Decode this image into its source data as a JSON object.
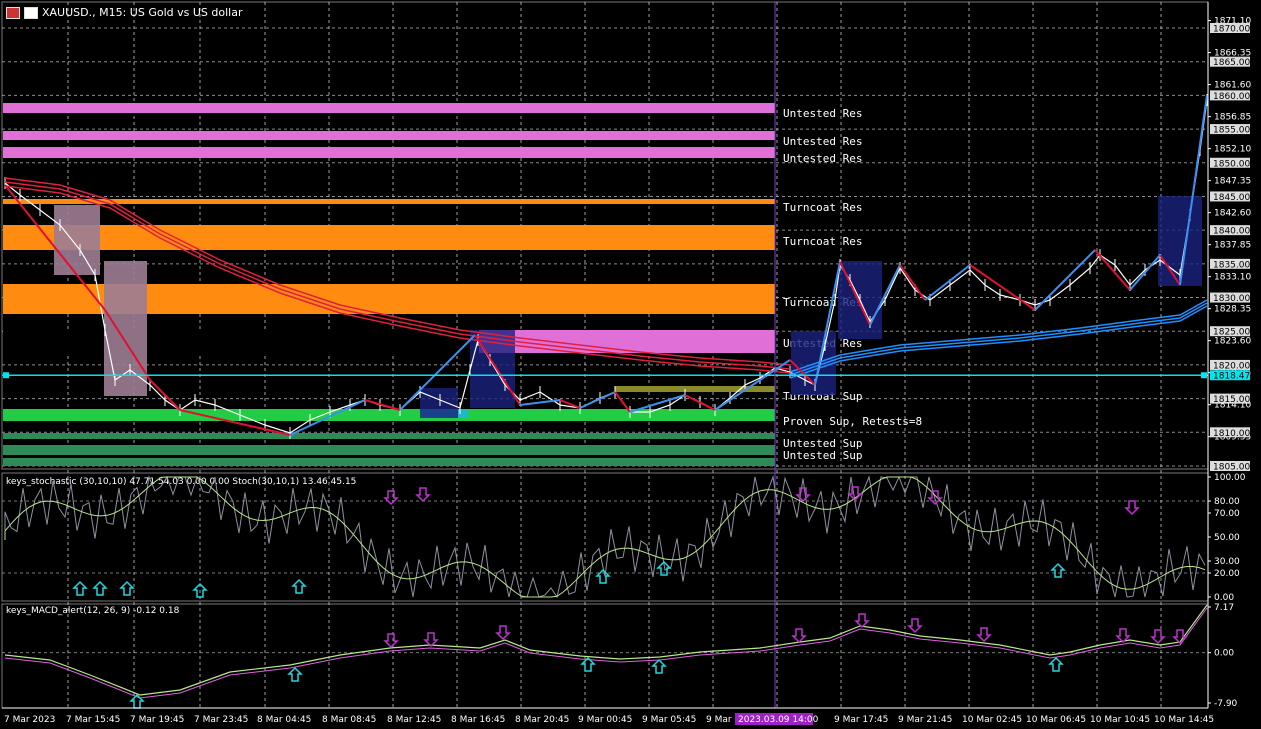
{
  "window": {
    "title": "XAUUSD., M15:  US Gold vs US dollar"
  },
  "colors": {
    "background": "#000000",
    "grid": "#c8c8c8",
    "untested_res": "#e070d8",
    "turncoat_res": "#ff8c10",
    "proven_sup": "#22cc44",
    "untested_sup": "#2e8b57",
    "candle": "#ffffff",
    "ma_red": "#e02040",
    "ma_blue": "#1e90ff",
    "zigzag_up": "#3a8ff0",
    "zigzag_down": "#e01030",
    "current_price": "#00e5ee",
    "stoch_main": "#9090a0",
    "stoch_signal": "#b8e88a",
    "arrow_up": "#20d8e0",
    "arrow_down": "#c030d0",
    "vline": "#7b3fd0"
  },
  "main_panel": {
    "price_labels": [
      "1871.10",
      "1866.35",
      "1861.60",
      "1856.85",
      "1852.10",
      "1847.35",
      "1842.60",
      "1837.85",
      "1833.10",
      "1828.35",
      "1823.60",
      "1818.85",
      "1814.10",
      "1809.35"
    ],
    "price_boxes": [
      "1870.00",
      "1865.00",
      "1860.00",
      "1855.00",
      "1850.00",
      "1845.00",
      "1840.00",
      "1835.00",
      "1830.00",
      "1825.00",
      "1820.00",
      "1815.00",
      "1810.00",
      "1805.00"
    ],
    "current_price": "1818.47",
    "zone_labels": [
      "Untested Res",
      "Untested Res",
      "Untested Res",
      "Turncoat Res",
      "Turncoat Res",
      "Turncoat Res",
      "Untested Res",
      "Turncoat Sup",
      "Proven Sup, Retests=8",
      "Untested Sup",
      "Untested Sup"
    ]
  },
  "stoch_panel": {
    "label": "keys_stochastic (30,10,10) 47.71 54.03 0.00 0.00 Stoch(30,10,1) 13.46 45.15",
    "levels": [
      "100.00",
      "80.00",
      "70.00",
      "50.00",
      "30.00",
      "20.00",
      "0.00"
    ]
  },
  "macd_panel": {
    "label": "keys_MACD_alert(12, 26, 9) -0.12 0.18",
    "levels": [
      "7.17",
      "0.00",
      "-7.90"
    ]
  },
  "time_axis": {
    "labels": [
      "7 Mar 2023",
      "7 Mar 15:45",
      "7 Mar 19:45",
      "7 Mar 23:45",
      "8 Mar 04:45",
      "8 Mar 08:45",
      "8 Mar 12:45",
      "8 Mar 16:45",
      "8 Mar 20:45",
      "9 Mar 00:45",
      "9 Mar 05:45",
      "9 Mar 09:45",
      "9 Mar 17:45",
      "9 Mar 21:45",
      "10 Mar 02:45",
      "10 Mar 06:45",
      "10 Mar 10:45",
      "10 Mar 14:45"
    ],
    "cursor_label": "2023.03.09 14:00"
  }
}
